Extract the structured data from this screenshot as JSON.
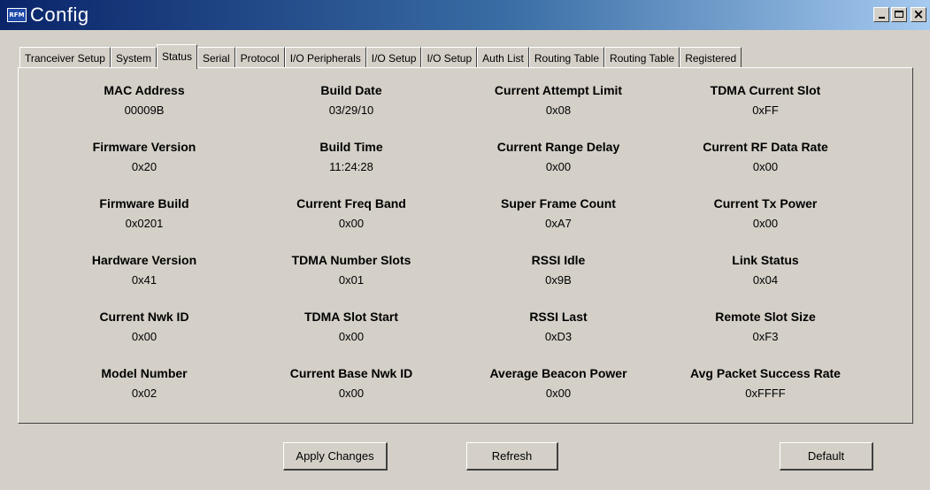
{
  "window": {
    "title": "Config",
    "icon_text": "RFM",
    "controls": {
      "min_icon": "minimize-icon",
      "max_icon": "maximize-icon",
      "close_glyph": "×"
    }
  },
  "tabs": [
    {
      "label": "Tranceiver Setup",
      "active": false
    },
    {
      "label": "System",
      "active": false
    },
    {
      "label": "Status",
      "active": true
    },
    {
      "label": "Serial",
      "active": false
    },
    {
      "label": "Protocol",
      "active": false
    },
    {
      "label": "I/O Peripherals",
      "active": false
    },
    {
      "label": "I/O Setup",
      "active": false
    },
    {
      "label": "I/O Setup",
      "active": false
    },
    {
      "label": "Auth List",
      "active": false
    },
    {
      "label": "Routing Table",
      "active": false
    },
    {
      "label": "Routing Table",
      "active": false
    },
    {
      "label": "Registered",
      "active": false
    }
  ],
  "status": {
    "fields": [
      {
        "label": "MAC Address",
        "value": "00009B"
      },
      {
        "label": "Build Date",
        "value": "03/29/10"
      },
      {
        "label": "Current Attempt Limit",
        "value": "0x08"
      },
      {
        "label": "TDMA Current Slot",
        "value": "0xFF"
      },
      {
        "label": "Firmware Version",
        "value": "0x20"
      },
      {
        "label": "Build Time",
        "value": "11:24:28"
      },
      {
        "label": "Current Range Delay",
        "value": "0x00"
      },
      {
        "label": "Current RF Data Rate",
        "value": "0x00"
      },
      {
        "label": "Firmware Build",
        "value": "0x0201"
      },
      {
        "label": "Current Freq Band",
        "value": "0x00"
      },
      {
        "label": "Super Frame Count",
        "value": "0xA7"
      },
      {
        "label": "Current Tx Power",
        "value": "0x00"
      },
      {
        "label": "Hardware Version",
        "value": "0x41"
      },
      {
        "label": "TDMA Number Slots",
        "value": "0x01"
      },
      {
        "label": "RSSI Idle",
        "value": "0x9B"
      },
      {
        "label": "Link Status",
        "value": "0x04"
      },
      {
        "label": "Current Nwk ID",
        "value": "0x00"
      },
      {
        "label": "TDMA Slot Start",
        "value": "0x00"
      },
      {
        "label": "RSSI Last",
        "value": "0xD3"
      },
      {
        "label": "Remote Slot Size",
        "value": "0xF3"
      },
      {
        "label": "Model Number",
        "value": "0x02"
      },
      {
        "label": "Current Base Nwk ID",
        "value": "0x00"
      },
      {
        "label": "Average Beacon Power",
        "value": "0x00"
      },
      {
        "label": "Avg Packet Success Rate",
        "value": "0xFFFF"
      }
    ]
  },
  "buttons": {
    "apply": "Apply Changes",
    "refresh": "Refresh",
    "default": "Default"
  }
}
